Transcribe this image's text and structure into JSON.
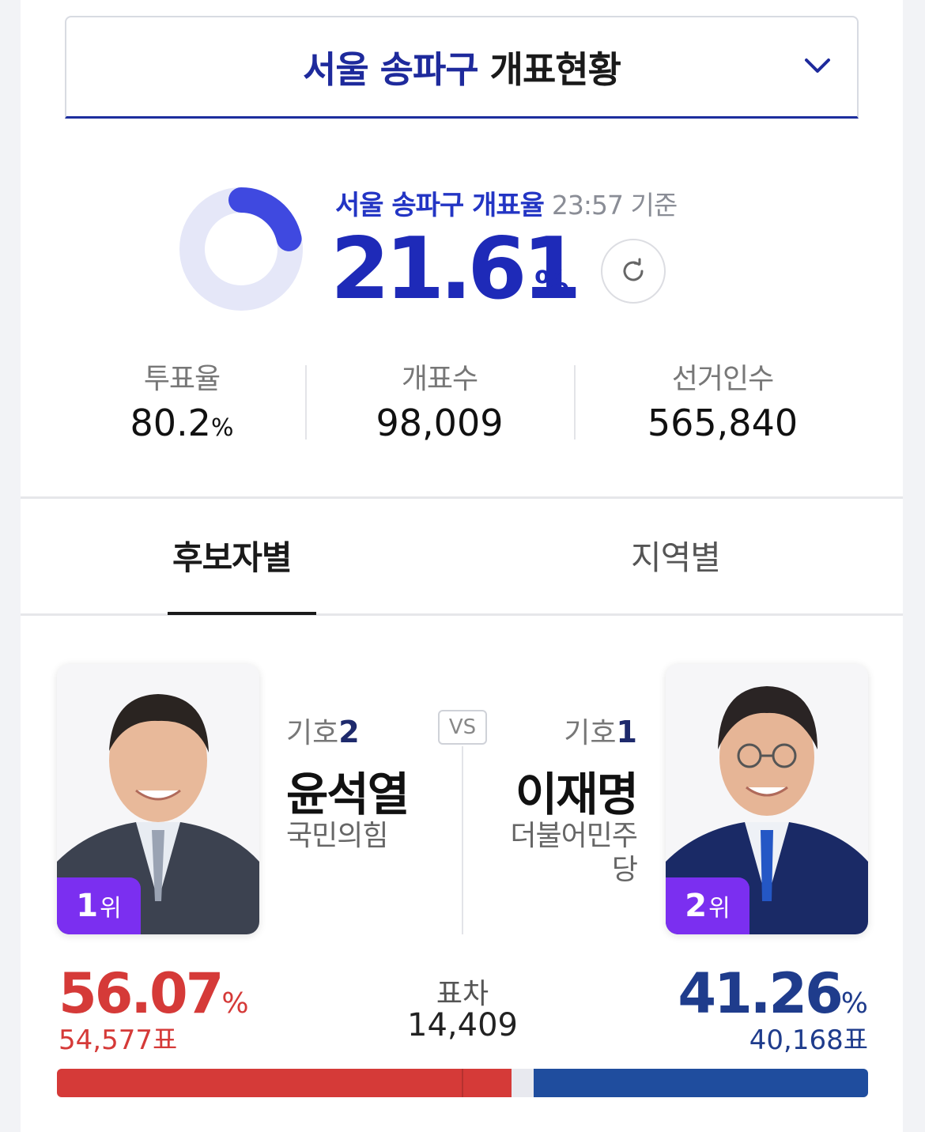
{
  "header": {
    "region": "서울 송파구",
    "title_suffix": "개표현황"
  },
  "count_rate": {
    "label": "서울 송파구 개표율",
    "time": "23:57 기준",
    "value": "21.61",
    "unit": "%",
    "progress": 0.2161
  },
  "stats": [
    {
      "label": "투표율",
      "value": "80.2",
      "unit": "%"
    },
    {
      "label": "개표수",
      "value": "98,009"
    },
    {
      "label": "선거인수",
      "value": "565,840"
    }
  ],
  "tabs": [
    {
      "label": "후보자별",
      "active": true
    },
    {
      "label": "지역별",
      "active": false
    }
  ],
  "candidates": {
    "left": {
      "ballot_prefix": "기호",
      "ballot_no": "2",
      "name": "윤석열",
      "party": "국민의힘",
      "rank_num": "1",
      "rank_suffix": "위",
      "pct": "56.07",
      "pct_unit": "%",
      "votes": "54,577표"
    },
    "right": {
      "ballot_prefix": "기호",
      "ballot_no": "1",
      "name": "이재명",
      "party_line1": "더불어민주",
      "party_line2": "당",
      "rank_num": "2",
      "rank_suffix": "위",
      "pct": "41.26",
      "pct_unit": "%",
      "votes": "40,168표"
    },
    "vs": "VS",
    "gap_label": "표차",
    "gap_value": "14,409"
  },
  "colors": {
    "accent": "#1e2ab8",
    "left_party": "#d53a38",
    "right_party": "#1f4d9e",
    "rank_badge": "#7b2ff0"
  },
  "bar": {
    "left_share": 0.5607,
    "right_share": 0.4126
  }
}
